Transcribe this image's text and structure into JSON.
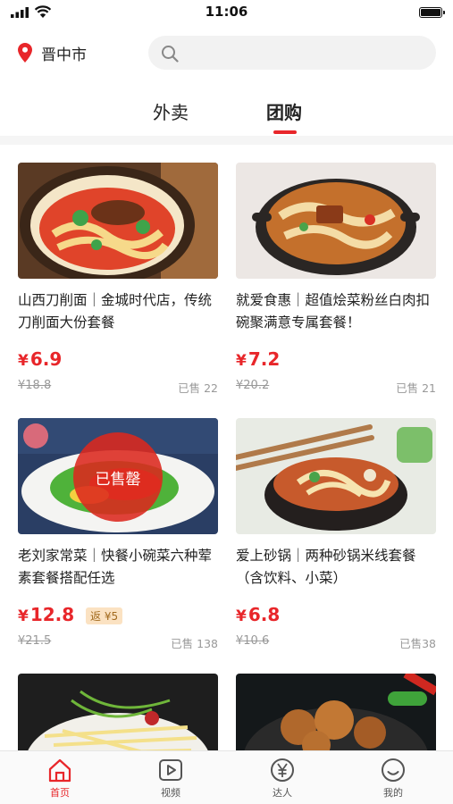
{
  "status": {
    "time": "11:06"
  },
  "header": {
    "city": "晋中市",
    "search_placeholder": ""
  },
  "tabs": [
    {
      "label": "外卖"
    },
    {
      "label": "团购",
      "active": true
    }
  ],
  "products": [
    {
      "title": "山西刀削面｜金城时代店，传统刀削面大份套餐",
      "currency": "¥",
      "price": "6.9",
      "original_price": "¥18.8",
      "sold": "已售 22",
      "rebate": "",
      "sold_out": ""
    },
    {
      "title": "就爱食惠｜超值烩菜粉丝白肉扣碗聚满意专属套餐！",
      "currency": "¥",
      "price": "7.2",
      "original_price": "¥20.2",
      "sold": "已售 21",
      "rebate": "",
      "sold_out": ""
    },
    {
      "title": "老刘家常菜｜快餐小碗菜六种荤素套餐搭配任选",
      "currency": "¥",
      "price": "12.8",
      "original_price": "¥21.5",
      "sold": "已售 138",
      "rebate": "返 ¥5",
      "sold_out": "已售罄"
    },
    {
      "title": "爱上砂锅｜两种砂锅米线套餐（含饮料、小菜）",
      "currency": "¥",
      "price": "6.8",
      "original_price": "¥10.6",
      "sold": "已售38",
      "rebate": "",
      "sold_out": ""
    }
  ],
  "bottom_nav": [
    {
      "label": "首页",
      "icon": "home-icon",
      "active": true
    },
    {
      "label": "视频",
      "icon": "video-play-icon"
    },
    {
      "label": "达人",
      "icon": "yen-circle-icon"
    },
    {
      "label": "我的",
      "icon": "smiley-icon"
    }
  ],
  "colors": {
    "accent": "#e8262a",
    "rebate_bg": "#fbe2c2",
    "rebate_text": "#a26a1e"
  }
}
